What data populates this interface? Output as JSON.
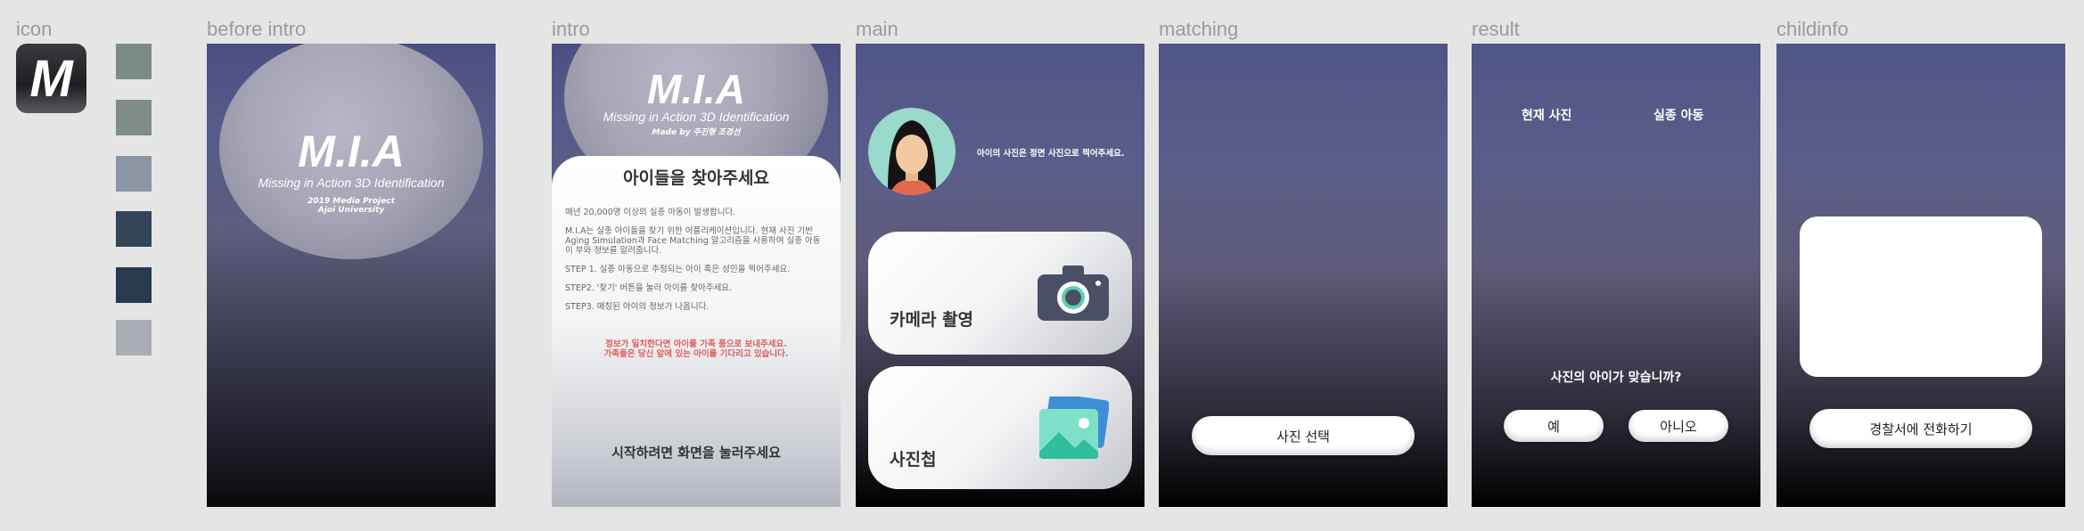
{
  "labels": {
    "icon": "icon",
    "before_intro": "before intro",
    "intro": "intro",
    "main": "main",
    "matching": "matching",
    "result": "result",
    "childinfo": "childinfo"
  },
  "app_icon": {
    "letter": "M"
  },
  "swatches": [
    "#7d8b86",
    "#7f8c87",
    "#8b95a3",
    "#334457",
    "#2a3a4e",
    "#a9adb3"
  ],
  "before_intro": {
    "title": "M.I.A",
    "subtitle": "Missing in Action 3D Identification",
    "line1": "2019 Media Project",
    "line2": "Ajoi University"
  },
  "intro": {
    "title": "M.I.A",
    "subtitle": "Missing in Action 3D Identification",
    "credit": "Made by 주진형 조경선",
    "heading": "아이들을 찾아주세요",
    "p1": "매년 20,000명 이상의 실종 아동이 발생합니다.",
    "p2": "M.I.A는 실종 아이들을 찾기 위한 어플리케이션입니다. 현재 사진 기반 Aging Simulation과 Face Matching 알고리즘을 사용하여 실종 아동 이 부와 정보를 알려줍니다.",
    "step1": "STEP 1. 실종 아동으로 추정되는 아이 혹은 성인을 찍어주세요.",
    "step2": "STEP2. '찾기' 버튼을 눌러 아이를 찾아주세요.",
    "step3": "STEP3. 매칭된 아이의 정보가 나옵니다.",
    "warn1": "정보가 일치한다면 아이를 가족 품으로 보내주세요.",
    "warn2": "가족들은 당신 앞에 있는 아이를 기다리고 있습니다.",
    "footer": "시작하려면 화면을 눌러주세요"
  },
  "main": {
    "hint": "아이의 사진은 정면 사진으로 찍어주세요.",
    "camera_label": "카메라 촬영",
    "album_label": "사진첩"
  },
  "matching": {
    "select_button": "사진 선택"
  },
  "result": {
    "current_photo": "현재 사진",
    "missing_child": "실종 아동",
    "question": "사진의 아이가 맞습니까?",
    "yes": "예",
    "no": "아니오"
  },
  "childinfo": {
    "call_button": "경찰서에 전화하기"
  }
}
